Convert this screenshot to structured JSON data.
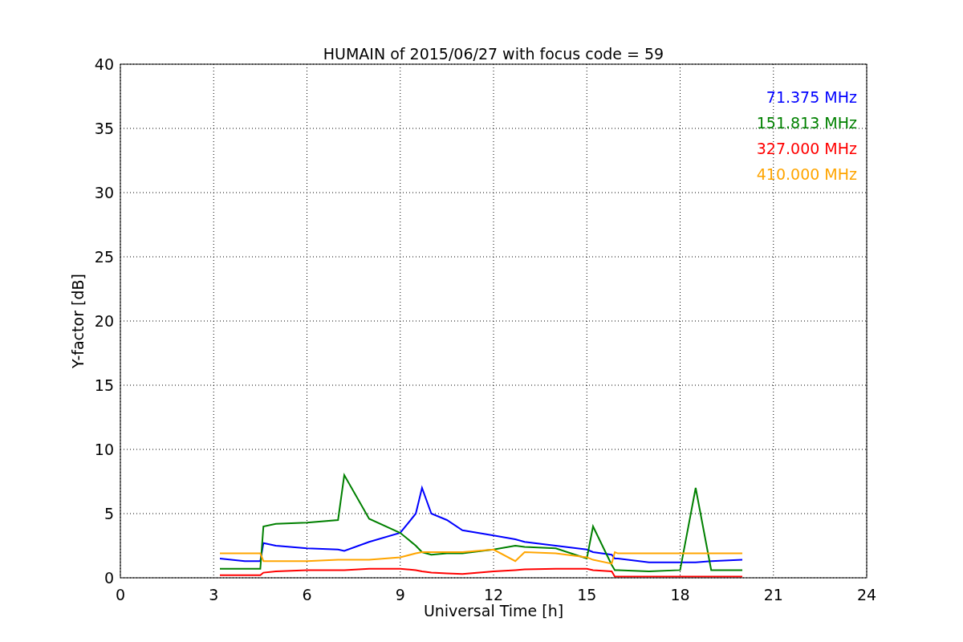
{
  "figure": {
    "chart_data": {
      "type": "line",
      "title": "HUMAIN of 2015/06/27 with focus code = 59",
      "xlabel": "Universal Time [h]",
      "ylabel": "Y-factor [dB]",
      "xlim": [
        0,
        24
      ],
      "ylim": [
        0,
        40
      ],
      "xticks": [
        0,
        3,
        6,
        9,
        12,
        15,
        18,
        21,
        24
      ],
      "yticks": [
        0,
        5,
        10,
        15,
        20,
        25,
        30,
        35,
        40
      ],
      "grid": true,
      "x": [
        3.2,
        4,
        4.5,
        4.6,
        5,
        6,
        7,
        7.2,
        8,
        9,
        9.5,
        9.7,
        10,
        10.5,
        11,
        12,
        12.7,
        13,
        14,
        15,
        15.2,
        15.8,
        15.9,
        16,
        17,
        18,
        18.5,
        19,
        20
      ],
      "series": [
        {
          "name": "71.375 MHz",
          "color": "#0000ff",
          "values": [
            1.5,
            1.3,
            1.3,
            2.7,
            2.5,
            2.3,
            2.2,
            2.1,
            2.8,
            3.5,
            5,
            7,
            5,
            4.5,
            3.7,
            3.3,
            3,
            2.8,
            2.5,
            2.2,
            2,
            1.8,
            1.5,
            1.5,
            1.2,
            1.2,
            1.2,
            1.3,
            1.4
          ]
        },
        {
          "name": "151.813 MHz",
          "color": "#008000",
          "values": [
            0.7,
            0.7,
            0.7,
            4,
            4.2,
            4.3,
            4.5,
            8,
            4.6,
            3.5,
            2.5,
            2,
            1.8,
            1.9,
            1.9,
            2.2,
            2.5,
            2.4,
            2.3,
            1.5,
            4,
            1,
            0.6,
            0.6,
            0.5,
            0.6,
            7,
            0.6,
            0.6
          ]
        },
        {
          "name": "327.000 MHz",
          "color": "#ff0000",
          "values": [
            0.2,
            0.2,
            0.2,
            0.4,
            0.5,
            0.6,
            0.6,
            0.6,
            0.7,
            0.7,
            0.6,
            0.5,
            0.4,
            0.35,
            0.3,
            0.5,
            0.6,
            0.65,
            0.7,
            0.7,
            0.6,
            0.5,
            0.1,
            0.1,
            0.1,
            0.1,
            0.1,
            0.1,
            0.1
          ]
        },
        {
          "name": "410.000 MHz",
          "color": "#ffa500",
          "values": [
            1.9,
            1.9,
            1.9,
            1.3,
            1.3,
            1.3,
            1.4,
            1.4,
            1.4,
            1.6,
            1.9,
            2,
            2,
            2,
            2,
            2.2,
            1.3,
            2,
            1.9,
            1.6,
            1.4,
            1.1,
            2,
            1.9,
            1.9,
            1.9,
            1.9,
            1.9,
            1.9
          ]
        }
      ]
    }
  }
}
